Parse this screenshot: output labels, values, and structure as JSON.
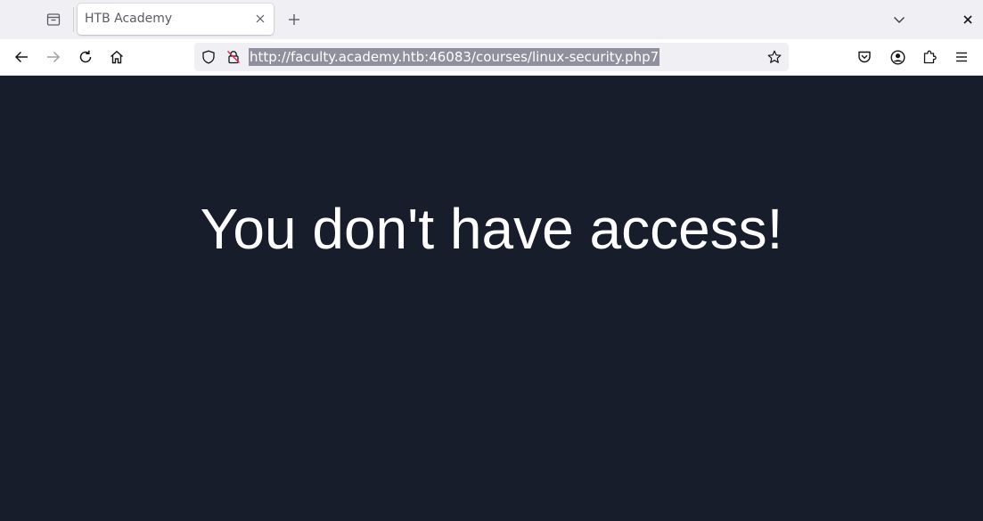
{
  "browser": {
    "tab": {
      "title": "HTB Academy"
    },
    "url": "http://faculty.academy.htb:46083/courses/linux-security.php7",
    "icons": {
      "tab_list": "list-all-tabs-icon",
      "tab_close": "close-icon",
      "new_tab": "plus-icon",
      "tabs_menu": "chevron-down-icon",
      "window_close": "close-icon",
      "back": "arrow-left-icon",
      "forward": "arrow-right-icon",
      "reload": "reload-icon",
      "home": "home-icon",
      "tracking_protection": "shield-icon",
      "insecure_connection": "insecure-lock-icon",
      "bookmark": "star-icon",
      "pocket": "pocket-icon",
      "account": "account-icon",
      "extensions": "puzzle-icon",
      "menu": "hamburger-menu-icon"
    }
  },
  "page": {
    "message": "You don't have access!",
    "background_color": "#171d2a",
    "text_color": "#ffffff"
  }
}
